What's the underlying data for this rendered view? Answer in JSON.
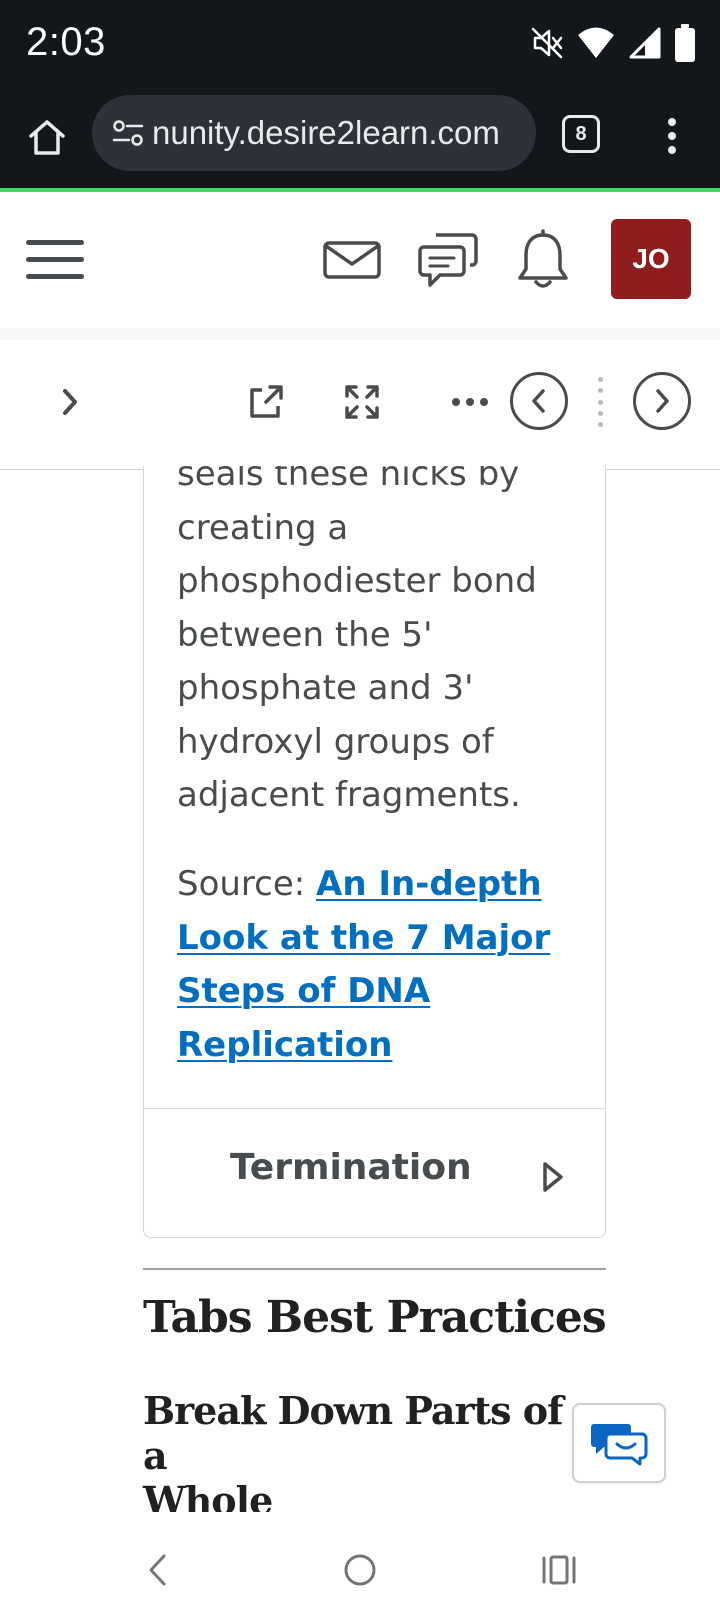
{
  "status_bar": {
    "time": "2:03",
    "icons": [
      "mute-icon",
      "wifi-icon",
      "signal-icon",
      "battery-icon"
    ]
  },
  "browser": {
    "url": "nunity.desire2learn.com",
    "tab_count": "8",
    "theme_line_color": "#3ddc64"
  },
  "header": {
    "avatar_initials": "JO",
    "avatar_color": "#8f1d1d",
    "icons": [
      "menu-icon",
      "mail-icon",
      "chat-icon",
      "bell-icon"
    ]
  },
  "toolbar": {
    "icons": [
      "chevron-right-icon",
      "open-external-icon",
      "fullscreen-icon",
      "more-icon",
      "previous-icon",
      "next-icon"
    ]
  },
  "content": {
    "body_lines": [
      "seals these nicks by",
      "creating a",
      "phosphodiester bond",
      "between the 5'",
      "phosphate and 3'",
      "hydroxyl groups of",
      "adjacent fragments."
    ],
    "source_label": "Source:",
    "source_link_lines": [
      "An In-depth",
      "Look at the 7 Major",
      "Steps of DNA",
      "Replication"
    ],
    "link_color": "#006fbf",
    "accordion_title": "Termination",
    "section_heading": "Tabs Best Practices",
    "sub_heading_lines": [
      "Break Down Parts of a",
      "Whole"
    ]
  },
  "nav_bar": {
    "icons": [
      "back-icon",
      "home-circle-icon",
      "recents-icon"
    ]
  }
}
